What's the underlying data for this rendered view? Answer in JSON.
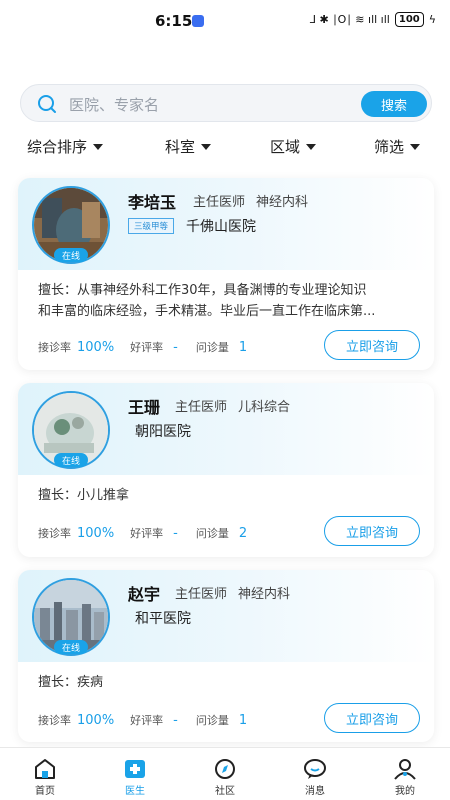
{
  "status_bar": {
    "time": "6:15",
    "signal_text": "⅃ ✱ ∣O∣ ≋ ıll ıll",
    "battery": "100"
  },
  "search": {
    "placeholder": "医院、专家名",
    "button_label": "搜索"
  },
  "filters": [
    {
      "label": "综合排序"
    },
    {
      "label": "科室"
    },
    {
      "label": "区域"
    },
    {
      "label": "筛选"
    }
  ],
  "doctors": [
    {
      "name": "李培玉",
      "title": "主任医师",
      "department": "神经内科",
      "hospital_level": "三级甲等",
      "hospital": "千佛山医院",
      "online": "在线",
      "skill_line1": "擅长：从事神经外科工作30年，具备渊博的专业理论知识",
      "skill_line2": "和丰富的临床经验，手术精湛。毕业后一直工作在临床第...",
      "accept_label": "接诊率",
      "accept_rate": "100%",
      "rating_label": "好评率",
      "rating": "-",
      "visits_label": "问诊量",
      "visits": "1",
      "consult_label": "立即咨询"
    },
    {
      "name": "王珊",
      "title": "主任医师",
      "department": "儿科综合",
      "hospital": "朝阳医院",
      "online": "在线",
      "skill_line1": "擅长：小儿推拿",
      "accept_label": "接诊率",
      "accept_rate": "100%",
      "rating_label": "好评率",
      "rating": "-",
      "visits_label": "问诊量",
      "visits": "2",
      "consult_label": "立即咨询"
    },
    {
      "name": "赵宇",
      "title": "主任医师",
      "department": "神经内科",
      "hospital": "和平医院",
      "online": "在线",
      "skill_line1": "擅长：疾病",
      "accept_label": "接诊率",
      "accept_rate": "100%",
      "rating_label": "好评率",
      "rating": "-",
      "visits_label": "问诊量",
      "visits": "1",
      "consult_label": "立即咨询"
    }
  ],
  "tabs": [
    {
      "label": "首页",
      "icon": "home-icon"
    },
    {
      "label": "医生",
      "icon": "doctor-icon",
      "active": true
    },
    {
      "label": "社区",
      "icon": "compass-icon"
    },
    {
      "label": "消息",
      "icon": "message-icon"
    },
    {
      "label": "我的",
      "icon": "profile-icon"
    }
  ],
  "colors": {
    "accent": "#1aa3e8",
    "card_header": "#dff3fb"
  }
}
